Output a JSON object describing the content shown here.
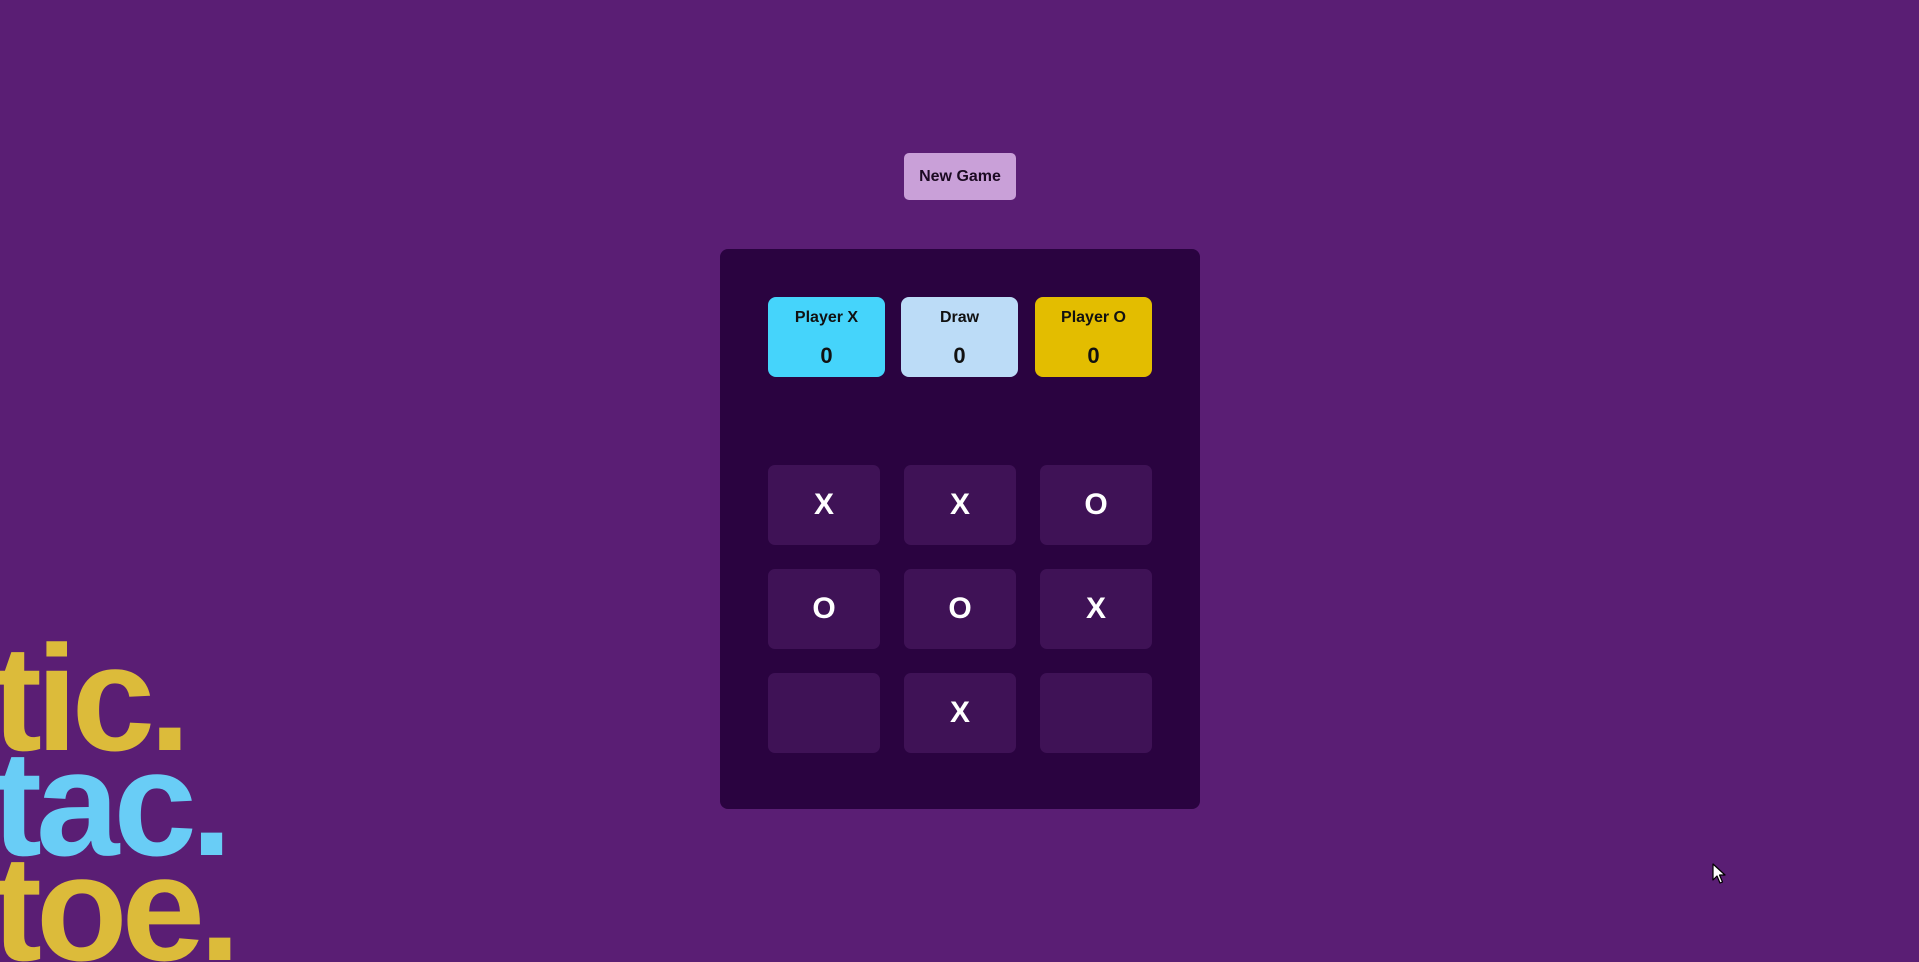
{
  "toolbar": {
    "new_game_label": "New Game"
  },
  "scoreboard": [
    {
      "label": "Player X",
      "value": "0",
      "color": "#45d4fb"
    },
    {
      "label": "Draw",
      "value": "0",
      "color": "#bcdcf7"
    },
    {
      "label": "Player O",
      "value": "0",
      "color": "#e3bd00"
    }
  ],
  "board": {
    "cells": [
      "X",
      "X",
      "O",
      "O",
      "O",
      "X",
      "",
      "X",
      ""
    ]
  },
  "logo": {
    "lines": [
      "tic.",
      "tac.",
      "toe."
    ],
    "colors": [
      "#dcbb3a",
      "#69cdf6",
      "#dcbb3a"
    ]
  },
  "colors": {
    "background": "#5a1e74",
    "panel": "#2a0340",
    "cell": "#3f1256",
    "button": "#c9a0d8"
  },
  "icons": {
    "cursor": "mouse-pointer-icon"
  }
}
